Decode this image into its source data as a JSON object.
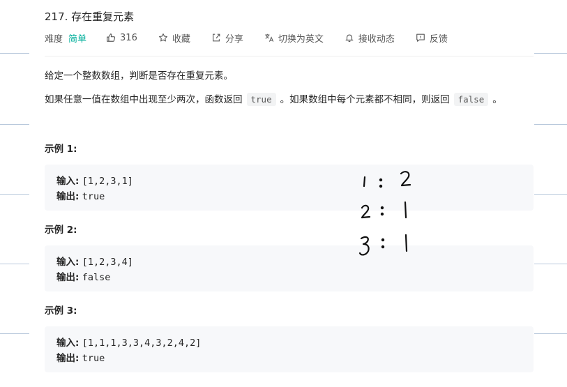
{
  "problem": {
    "title": "217. 存在重复元素",
    "difficulty_label": "难度",
    "difficulty_value": "简单",
    "likes": "316",
    "favorite": "收藏",
    "share": "分享",
    "switch_lang": "切换为英文",
    "subscribe": "接收动态",
    "feedback": "反馈"
  },
  "description": {
    "line1": "给定一个整数数组，判断是否存在重复元素。",
    "line2_a": "如果任意一值在数组中出现至少两次，函数返回",
    "line2_code1": "true",
    "line2_b": "。如果数组中每个元素都不相同，则返回",
    "line2_code2": "false",
    "line2_c": "。"
  },
  "examples": [
    {
      "title": "示例 1:",
      "input_label": "输入:",
      "input": "[1,2,3,1]",
      "output_label": "输出:",
      "output": "true"
    },
    {
      "title": "示例 2:",
      "input_label": "输入:",
      "input": "[1,2,3,4]",
      "output_label": "输出:",
      "output": "false"
    },
    {
      "title": "示例 3:",
      "input_label": "输入:",
      "input": "[1,1,1,3,3,4,3,2,4,2]",
      "output_label": "输出:",
      "output": "true"
    }
  ],
  "icons": {
    "likes": "thumbs-up-icon",
    "favorite": "star-icon",
    "share": "share-icon",
    "switch_lang": "translate-icon",
    "subscribe": "bell-icon",
    "feedback": "feedback-icon"
  },
  "handwriting": {
    "lines": [
      "1 : 2",
      "2 : 1",
      "3 : 1"
    ]
  },
  "colors": {
    "difficulty_easy": "#00af9b",
    "code_bg": "#f7f8fa",
    "background_lines": "#b9c9dc"
  }
}
